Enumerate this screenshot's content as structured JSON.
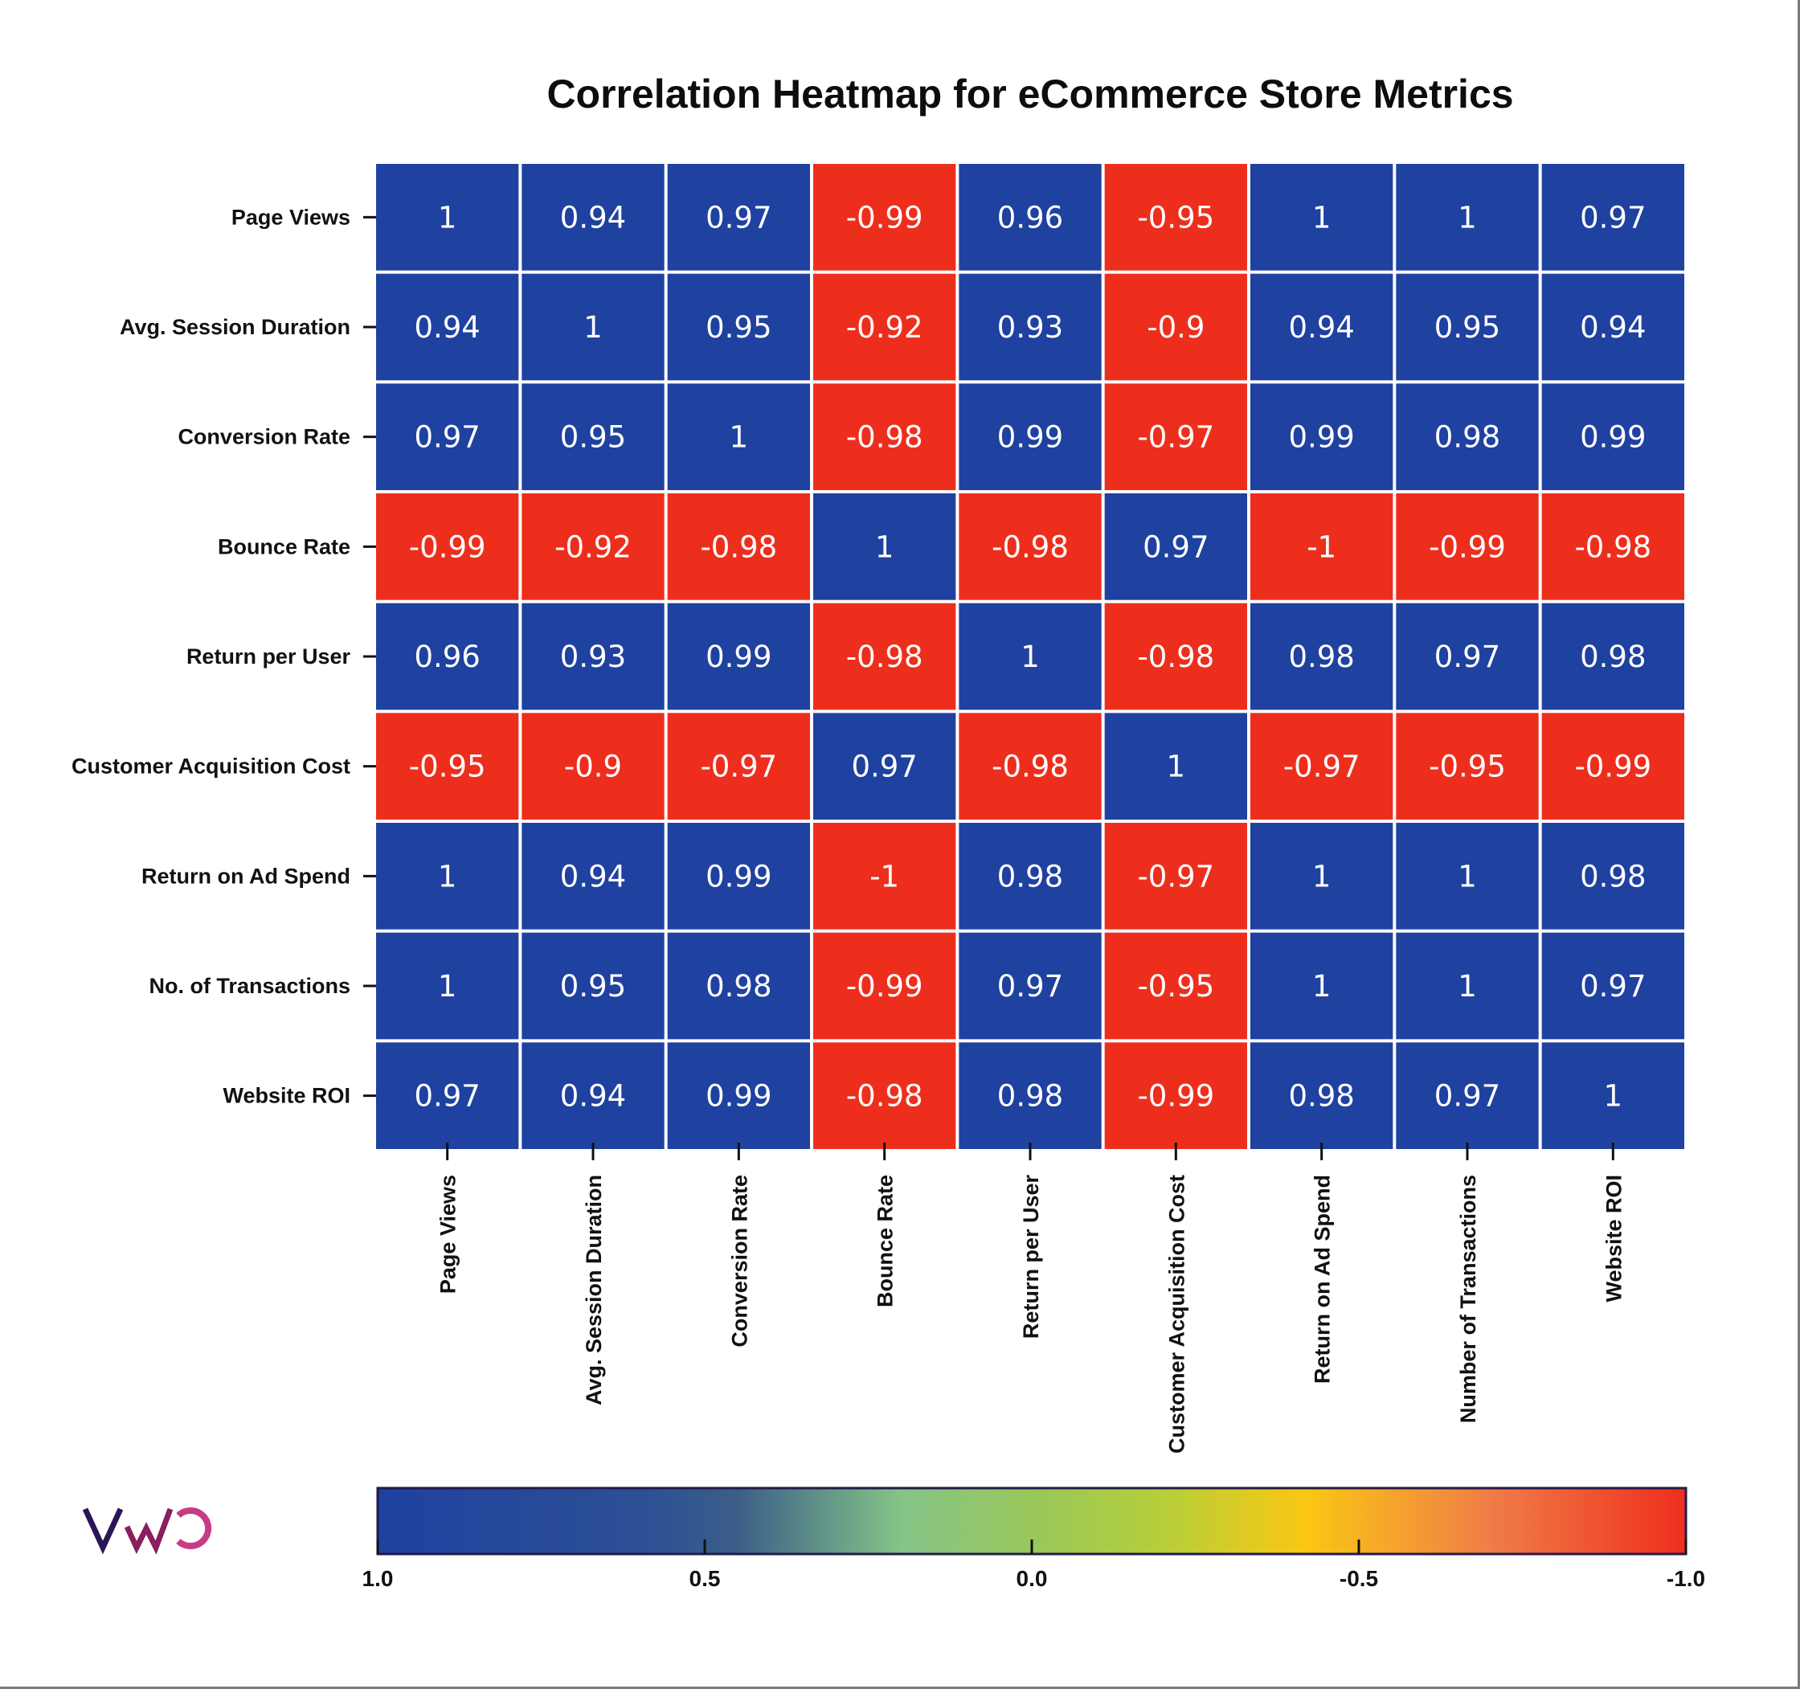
{
  "chart_data": {
    "type": "heatmap",
    "title": "Correlation Heatmap for eCommerce Store Metrics",
    "row_labels": [
      "Page Views",
      "Avg. Session Duration",
      "Conversion Rate",
      "Bounce Rate",
      "Return per User",
      "Customer Acquisition Cost",
      "Return on Ad Spend",
      "No. of Transactions",
      "Website ROI"
    ],
    "col_labels": [
      "Page Views",
      "Avg. Session Duration",
      "Conversion Rate",
      "Bounce Rate",
      "Return per User",
      "Customer Acquisition Cost",
      "Return on Ad Spend",
      "Number of Transactions",
      "Website ROI"
    ],
    "values": [
      [
        1,
        0.94,
        0.97,
        -0.99,
        0.96,
        -0.95,
        1,
        1,
        0.97
      ],
      [
        0.94,
        1,
        0.95,
        -0.92,
        0.93,
        -0.9,
        0.94,
        0.95,
        0.94
      ],
      [
        0.97,
        0.95,
        1,
        -0.98,
        0.99,
        -0.97,
        0.99,
        0.98,
        0.99
      ],
      [
        -0.99,
        -0.92,
        -0.98,
        1,
        -0.98,
        0.97,
        -1,
        -0.99,
        -0.98
      ],
      [
        0.96,
        0.93,
        0.99,
        -0.98,
        1,
        -0.98,
        0.98,
        0.97,
        0.98
      ],
      [
        -0.95,
        -0.9,
        -0.97,
        0.97,
        -0.98,
        1,
        -0.97,
        -0.95,
        -0.99
      ],
      [
        1,
        0.94,
        0.99,
        -1,
        0.98,
        -0.97,
        1,
        1,
        0.98
      ],
      [
        1,
        0.95,
        0.98,
        -0.99,
        0.97,
        -0.95,
        1,
        1,
        0.97
      ],
      [
        0.97,
        0.94,
        0.99,
        -0.98,
        0.98,
        -0.99,
        0.98,
        0.97,
        1
      ]
    ],
    "value_range": [
      -1.0,
      1.0
    ],
    "colorbar": {
      "orientation": "horizontal",
      "placement": "bottom",
      "ticks": [
        1.0,
        0.5,
        0.0,
        -0.5,
        -1.0
      ],
      "tick_labels": [
        "1.0",
        "0.5",
        "0.0",
        "-0.5",
        "-1.0"
      ],
      "direction": "descending left-to-right"
    },
    "colors": {
      "positive": "#1f41a0",
      "negative": "#ee2e1d",
      "gradient_stops": [
        {
          "value": 1.0,
          "color": "#1f41a0"
        },
        {
          "value": 0.6,
          "color": "#2c4f95"
        },
        {
          "value": 0.45,
          "color": "#3b5e88"
        },
        {
          "value": 0.2,
          "color": "#85c487"
        },
        {
          "value": 0.0,
          "color": "#98c75a"
        },
        {
          "value": -0.2,
          "color": "#b6cf3a"
        },
        {
          "value": -0.42,
          "color": "#fac712"
        },
        {
          "value": -0.7,
          "color": "#ef7d48"
        },
        {
          "value": -1.0,
          "color": "#ee2e1d"
        }
      ],
      "cell_text": "#ffffff",
      "grid_line": "#ffffff"
    },
    "xlabel": "",
    "ylabel": ""
  },
  "branding": {
    "logo_text": "VWO",
    "logo_colors": [
      "#2a1656",
      "#8a1e5e",
      "#c93b86"
    ]
  }
}
